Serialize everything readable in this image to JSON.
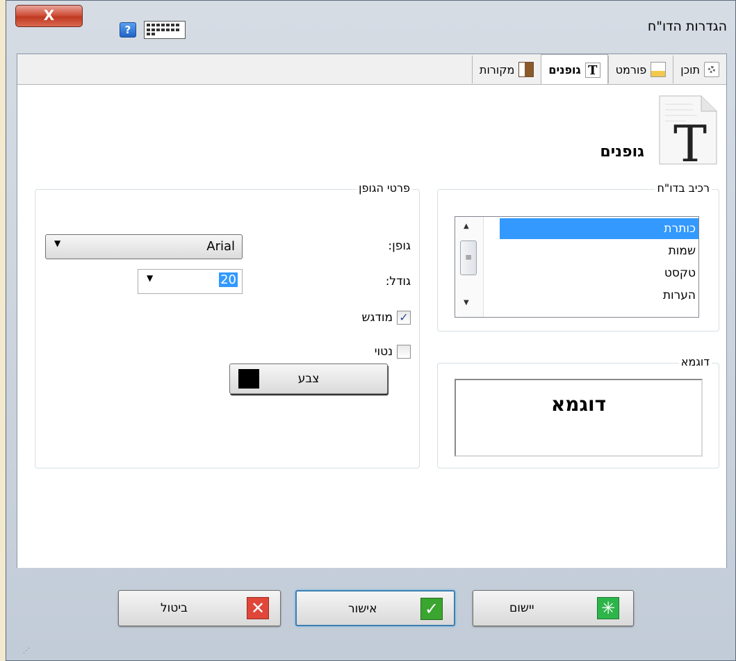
{
  "window": {
    "title": "הגדרות הדו\"ח",
    "close_glyph": "X",
    "help_glyph": "?"
  },
  "tabs": [
    {
      "label": "תוכן",
      "icon": "gear-page-icon"
    },
    {
      "label": "פורמט",
      "icon": "format-page-icon"
    },
    {
      "label": "גופנים",
      "icon": "font-page-icon",
      "active": true
    },
    {
      "label": "מקורות",
      "icon": "clipboard-icon"
    }
  ],
  "page": {
    "heading": "גופנים",
    "heading_glyph": "T"
  },
  "report_component": {
    "legend": "רכיב בדו\"ח",
    "items": [
      "כותרת",
      "שמות",
      "טקסט",
      "הערות"
    ],
    "selected_index": 0
  },
  "sample": {
    "legend": "דוגמא",
    "text": "דוגמא"
  },
  "font_details": {
    "legend": "פרטי הגופן",
    "font_label": "גופן:",
    "font_value": "Arial",
    "size_label": "גודל:",
    "size_value": "20",
    "bold_label": "מודגש",
    "bold_checked": true,
    "italic_label": "נטוי",
    "italic_checked": false,
    "color_label": "צבע",
    "color_value": "#000000"
  },
  "buttons": {
    "cancel": "ביטול",
    "ok": "אישור",
    "apply": "יישום"
  },
  "colors": {
    "selection": "#3399ff",
    "cancel_icon": "#e0473a",
    "ok_icon": "#3aa52f",
    "apply_icon": "#2db54a"
  }
}
